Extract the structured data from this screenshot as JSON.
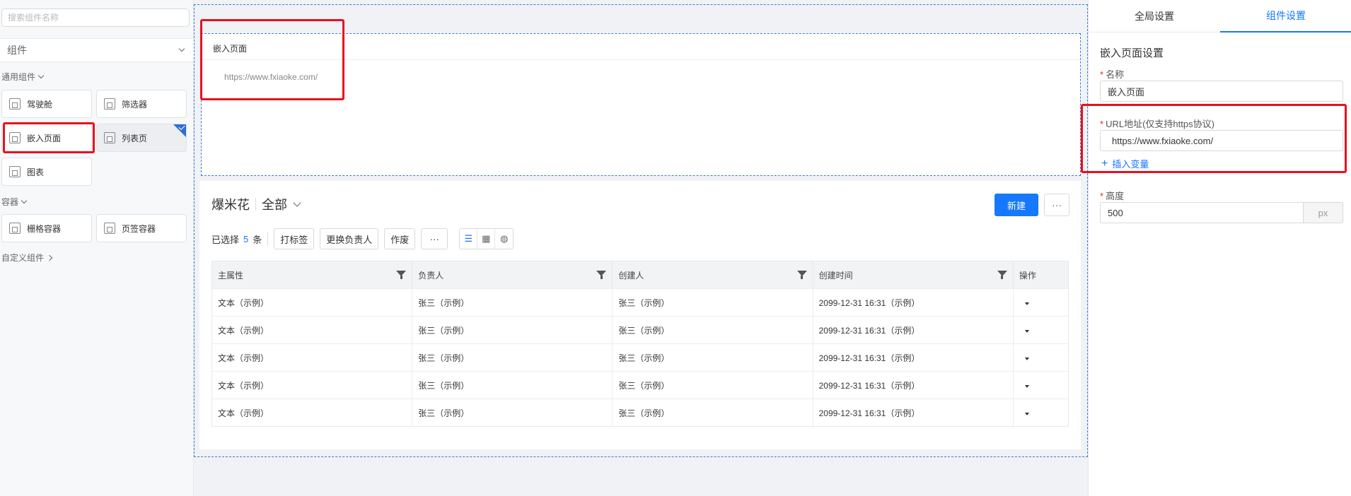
{
  "left": {
    "search_placeholder": "搜索组件名称",
    "category": "组件",
    "sections": {
      "common": "通用组件",
      "container": "容器",
      "custom": "自定义组件"
    },
    "components": {
      "cockpit": "驾驶舱",
      "filter": "筛选器",
      "embed_page": "嵌入页面",
      "list_page": "列表页",
      "chart": "图表",
      "grid_container": "栅格容器",
      "tab_container": "页签容器"
    }
  },
  "canvas": {
    "embed": {
      "title": "嵌入页面",
      "url": "https://www.fxiaoke.com/"
    },
    "list": {
      "title": "爆米花",
      "view": "全部",
      "new_button": "新建",
      "more_button": "···",
      "selected_prefix": "已选择",
      "selected_count": "5",
      "selected_suffix": "条",
      "actions": {
        "tag": "打标签",
        "change_owner": "更换负责人",
        "void": "作废",
        "more": "···"
      },
      "columns": [
        "主属性",
        "负责人",
        "创建人",
        "创建时间",
        "操作"
      ],
      "rows": [
        [
          "文本（示例）",
          "张三（示例）",
          "张三（示例）",
          "2099-12-31 16:31（示例）"
        ],
        [
          "文本（示例）",
          "张三（示例）",
          "张三（示例）",
          "2099-12-31 16:31（示例）"
        ],
        [
          "文本（示例）",
          "张三（示例）",
          "张三（示例）",
          "2099-12-31 16:31（示例）"
        ],
        [
          "文本（示例）",
          "张三（示例）",
          "张三（示例）",
          "2099-12-31 16:31（示例）"
        ],
        [
          "文本（示例）",
          "张三（示例）",
          "张三（示例）",
          "2099-12-31 16:31（示例）"
        ]
      ]
    }
  },
  "right": {
    "tabs": [
      "全局设置",
      "组件设置"
    ],
    "active_tab": "组件设置",
    "heading": "嵌入页面设置",
    "name_label": "名称",
    "name_value": "嵌入页面",
    "url_label": "URL地址(仅支持https协议)",
    "url_value": "https://www.fxiaoke.com/",
    "insert_variable": "插入变量",
    "height_label": "高度",
    "height_value": "500",
    "height_unit": "px"
  },
  "colors": {
    "accent": "#1677ff",
    "highlight": "#e8101e",
    "selection_border": "#3a7bd5"
  }
}
